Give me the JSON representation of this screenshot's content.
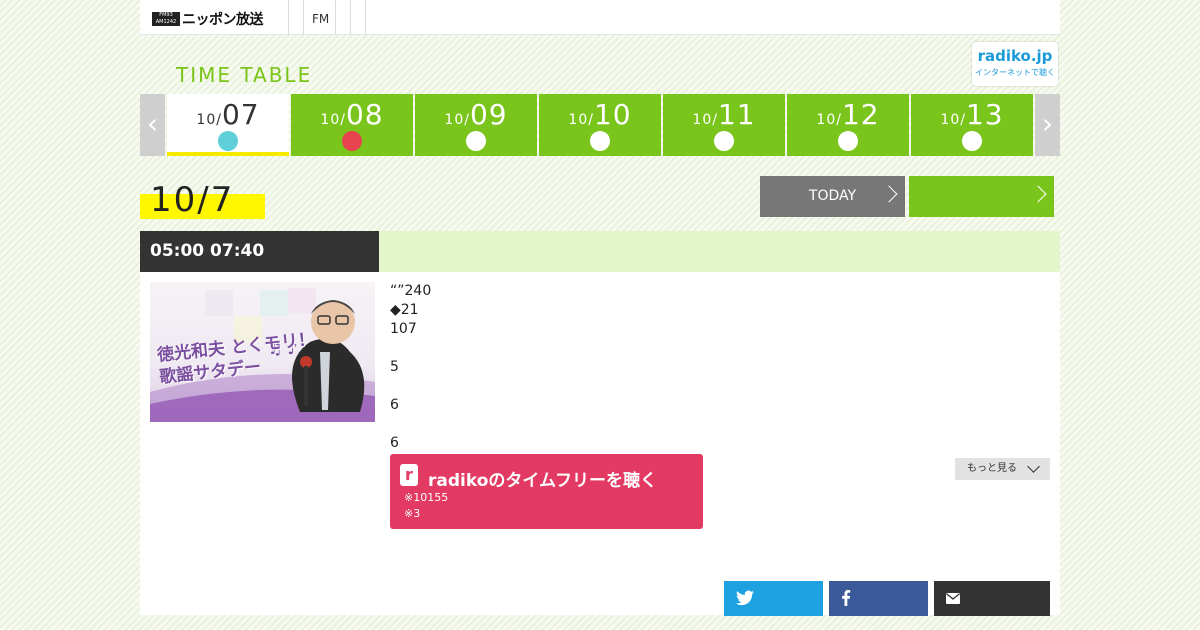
{
  "header": {
    "logo_mark": "FM93 AM1242",
    "logo_name": "ニッポン放送",
    "nav": [
      "FM",
      "",
      ""
    ]
  },
  "timetable": {
    "title": "TIME TABLE",
    "radiko_badge": {
      "name": "radiko.jp",
      "tagline": "インターネットで聴く"
    }
  },
  "date_strip": {
    "prev_icon": "chevron-left-icon",
    "next_icon": "chevron-right-icon",
    "days": [
      {
        "month": "10/",
        "day": "07",
        "dot_color": "#5fcfd9",
        "active": true
      },
      {
        "month": "10/",
        "day": "08",
        "dot_color": "#e8444f",
        "active": false
      },
      {
        "month": "10/",
        "day": "09",
        "dot_color": "#ffffff",
        "active": false
      },
      {
        "month": "10/",
        "day": "10",
        "dot_color": "#ffffff",
        "active": false
      },
      {
        "month": "10/",
        "day": "11",
        "dot_color": "#ffffff",
        "active": false
      },
      {
        "month": "10/",
        "day": "12",
        "dot_color": "#ffffff",
        "active": false
      },
      {
        "month": "10/",
        "day": "13",
        "dot_color": "#ffffff",
        "active": false
      }
    ]
  },
  "date_header": {
    "date": "10/7",
    "today_label": "TODAY",
    "next_label": ""
  },
  "program": {
    "time": "05:00  07:40",
    "thumbnail_caption": "徳光和夫 とくモリ！歌謡サタデー",
    "description": [
      "“”240",
      "◆21",
      "107",
      "",
      "5",
      "",
      "6",
      "",
      "6"
    ],
    "radiko_timefree": {
      "title": "radikoのタイムフリーを聴く",
      "note1": "※10155",
      "note2": "※3"
    },
    "more_label": "もっと見る"
  },
  "share": {
    "twitter_icon": "twitter-icon",
    "facebook_icon": "facebook-icon",
    "mail_icon": "mail-icon"
  },
  "colors": {
    "green": "#7ac51c",
    "pink": "#e33a64",
    "dark": "#333333",
    "yellow": "#fff700",
    "twitter": "#1da1e0",
    "facebook": "#3b5998"
  }
}
